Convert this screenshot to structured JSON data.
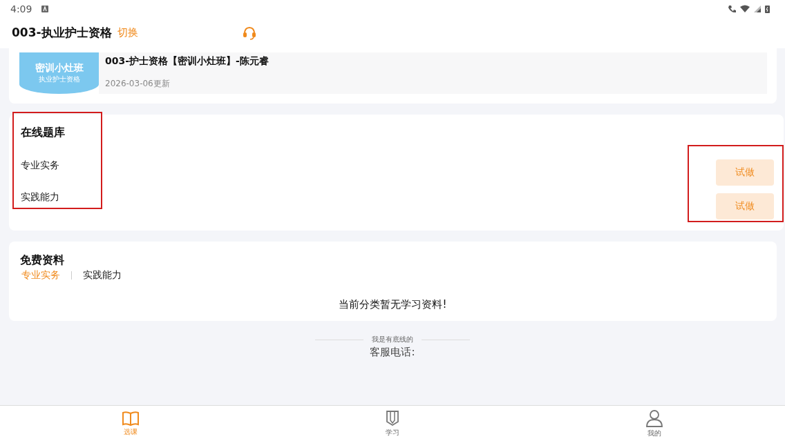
{
  "status_bar": {
    "time": "4:09"
  },
  "header": {
    "title": "003-执业护士资格",
    "switch": "切换"
  },
  "course": {
    "thumb_title": "密训小灶班",
    "thumb_subtitle": "执业护士资格",
    "title": "003-护士资格【密训小灶班】-陈元睿",
    "updated": "2026-03-06更新"
  },
  "question_bank": {
    "title": "在线题库",
    "items": [
      {
        "name": "专业实务",
        "action": "试做"
      },
      {
        "name": "实践能力",
        "action": "试做"
      }
    ]
  },
  "free_materials": {
    "title": "免费资料",
    "tabs": [
      {
        "label": "专业实务",
        "selected": true
      },
      {
        "label": "实践能力",
        "selected": false
      }
    ],
    "empty": "当前分类暂无学习资料!"
  },
  "footer": {
    "divider_text": "我是有底线的",
    "service": "客服电话:"
  },
  "nav": [
    {
      "label": "选课",
      "kind": "book",
      "selected": true
    },
    {
      "label": "学习",
      "kind": "pencil",
      "selected": false
    },
    {
      "label": "我的",
      "kind": "person",
      "selected": false
    }
  ]
}
